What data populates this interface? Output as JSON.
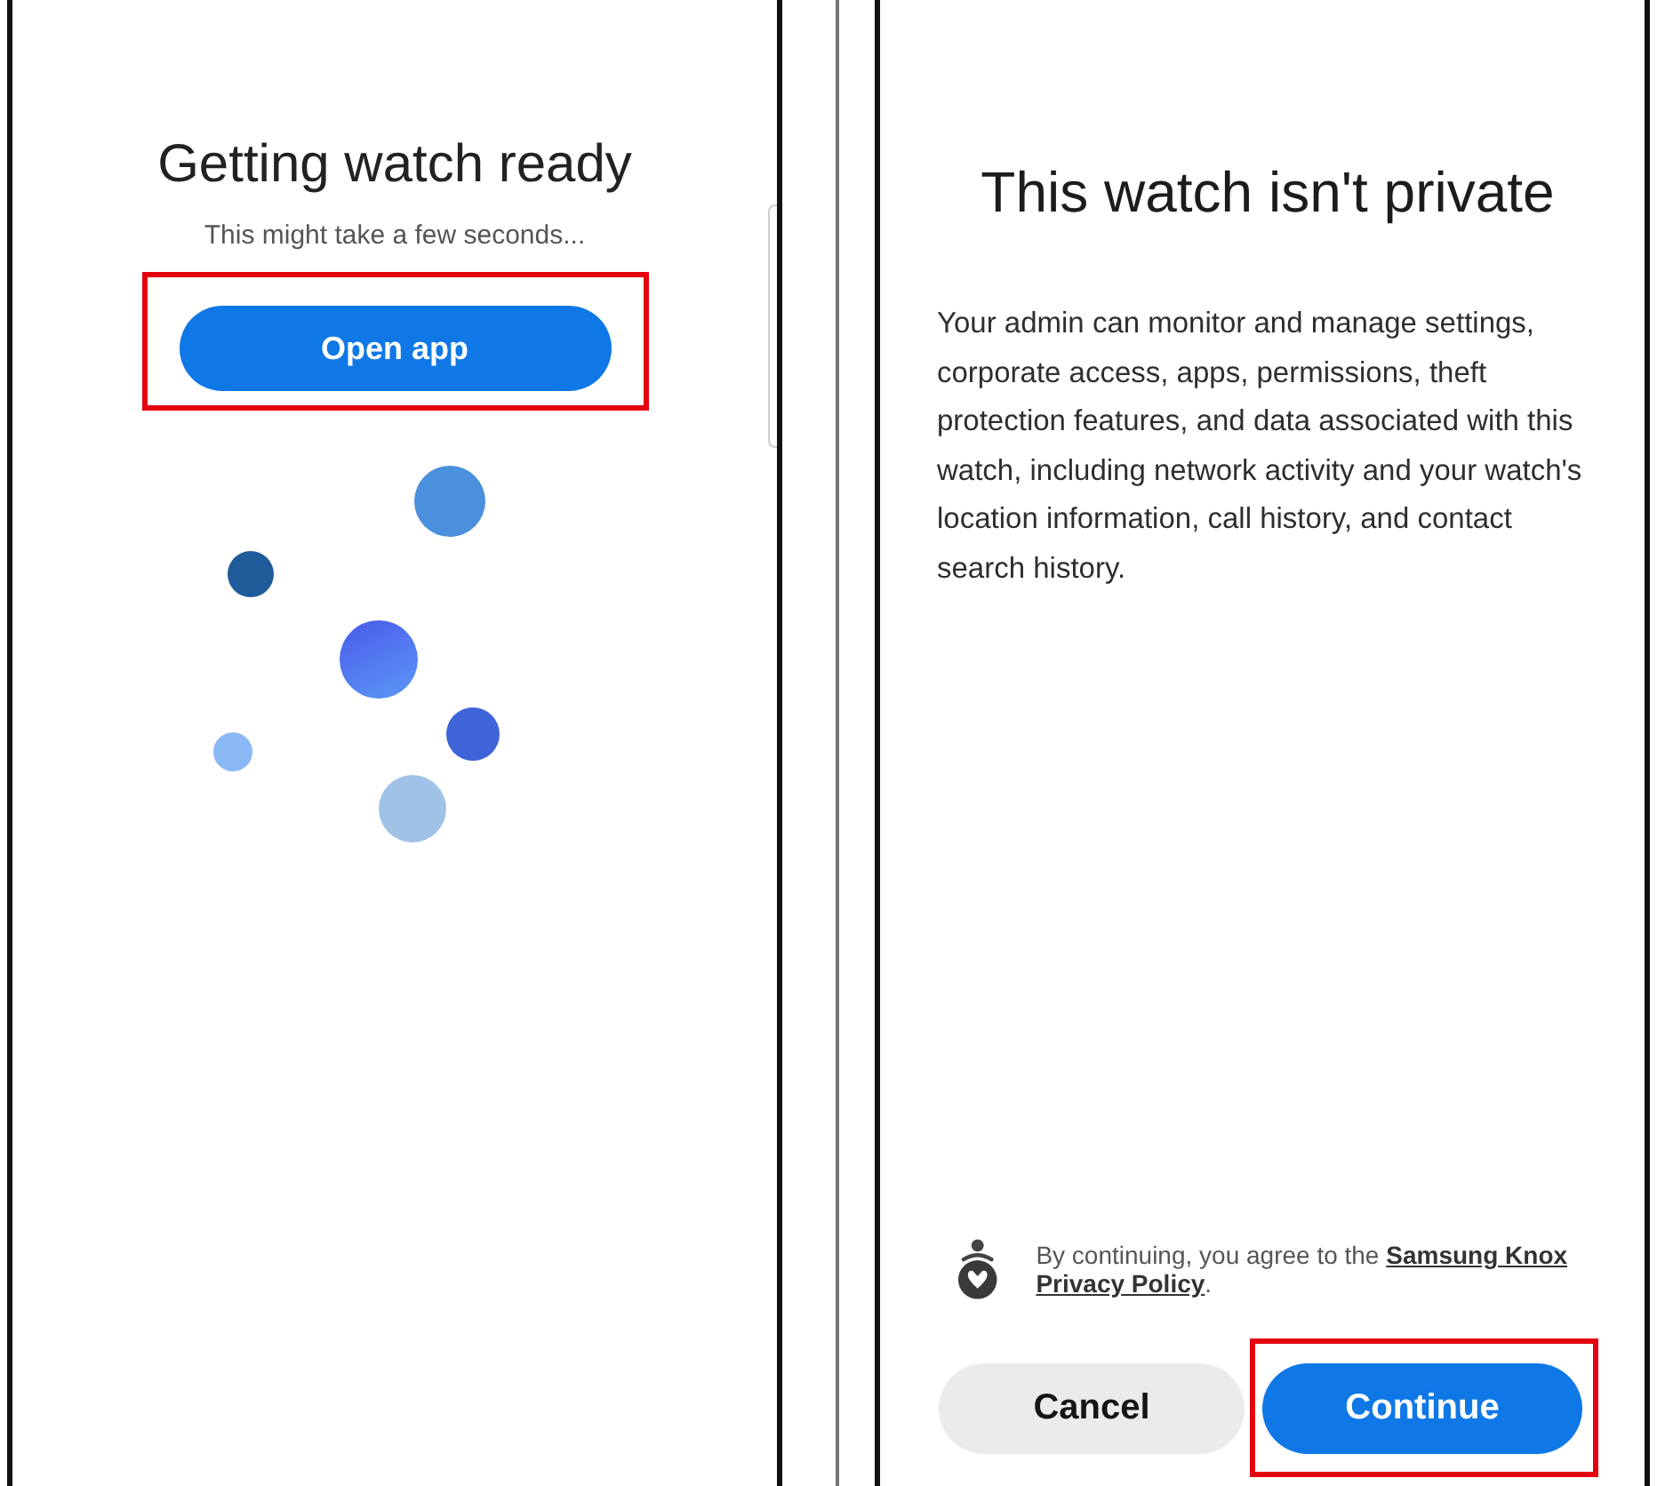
{
  "setup_screen": {
    "title": "Getting watch ready",
    "subtitle": "This might take a few seconds...",
    "button": {
      "label": "Open app",
      "kind": "primary",
      "highlighted": true
    }
  },
  "privacy_screen": {
    "title": "This watch isn't private",
    "body": "Your admin can monitor and manage settings, corporate access, apps, permissions, theft protection features, and data associated with this watch, including network activity and your watch's location information, call history, and contact search history.",
    "consent": {
      "text": "By continuing, you agree to the",
      "link_lines": [
        "Samsung Knox",
        "Privacy Policy"
      ],
      "end": "."
    },
    "buttons": [
      {
        "label": "Cancel",
        "kind": "secondary",
        "highlighted": false
      },
      {
        "label": "Continue",
        "kind": "primary",
        "highlighted": true
      }
    ]
  }
}
